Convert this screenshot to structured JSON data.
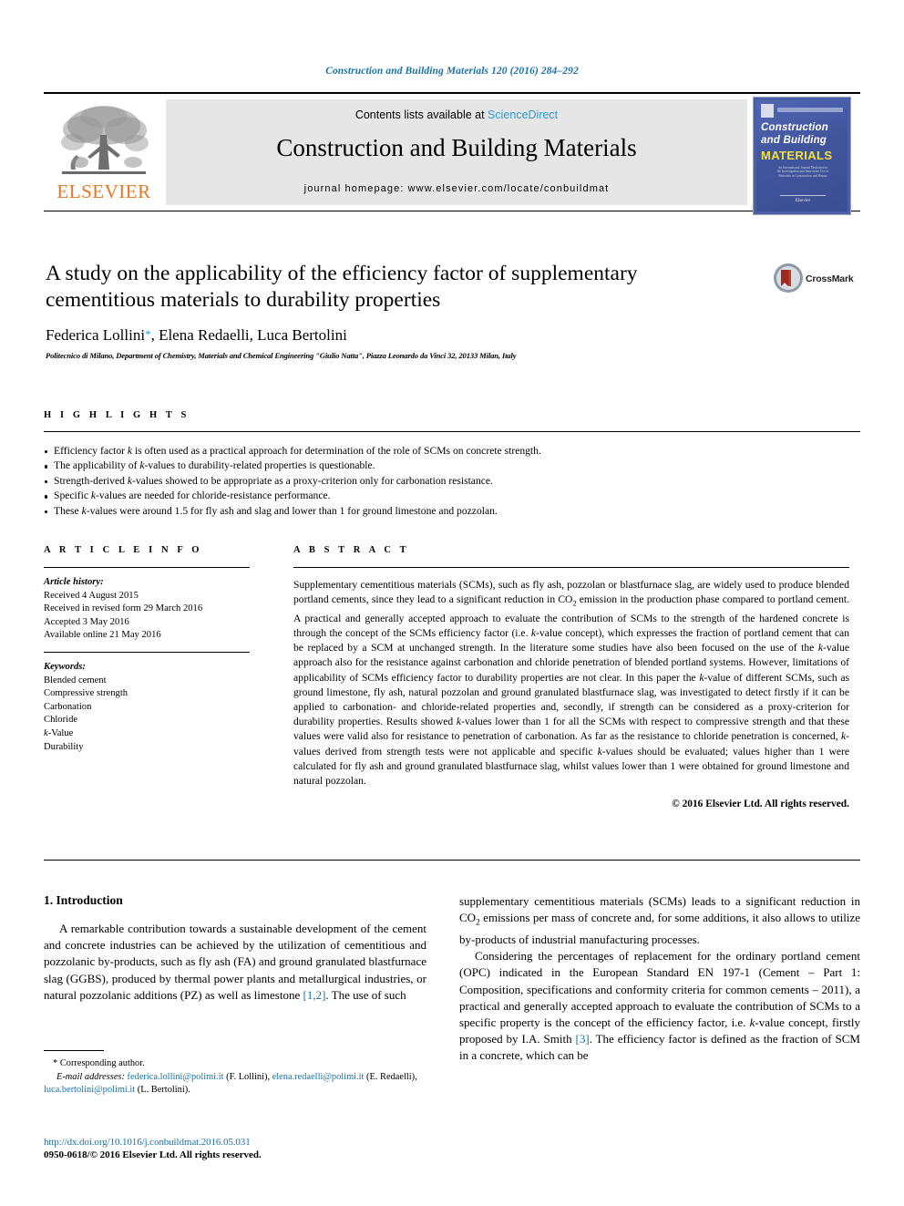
{
  "running_head": "Construction and Building Materials 120 (2016) 284–292",
  "masthead": {
    "contents_prefix": "Contents lists available at ",
    "sciencedirect": "ScienceDirect",
    "journal_title": "Construction and Building Materials",
    "homepage": "journal homepage: www.elsevier.com/locate/conbuildmat",
    "publisher_logo_text": "ELSEVIER",
    "cover": {
      "line1": "Construction",
      "line2": "and Building",
      "line3": "MATERIALS",
      "blurb": "An International Journal Dedicated to the Investigation and Innovative Use of Materials in Construction and Repair",
      "footer": "Elsevier"
    }
  },
  "article": {
    "title": "A study on the applicability of the efficiency factor of supplementary cementitious materials to durability properties",
    "authors": "Federica Lollini",
    "authors_rest": ", Elena Redaelli, Luca Bertolini",
    "corresponding_marker": "*",
    "affiliation": "Politecnico di Milano, Department of Chemistry, Materials and Chemical Engineering \"Giulio Natta\", Piazza Leonardo da Vinci 32, 20133 Milan, Italy",
    "crossmark_label": "CrossMark"
  },
  "highlights": {
    "label": "H I G H L I G H T S",
    "items": [
      "Efficiency factor k is often used as a practical approach for determination of the role of SCMs on concrete strength.",
      "The applicability of k-values to durability-related properties is questionable.",
      "Strength-derived k-values showed to be appropriate as a proxy-criterion only for carbonation resistance.",
      "Specific k-values are needed for chloride-resistance performance.",
      "These k-values were around 1.5 for fly ash and slag and lower than 1 for ground limestone and pozzolan."
    ]
  },
  "article_info": {
    "label": "A R T I C L E   I N F O",
    "history_title": "Article history:",
    "history": [
      "Received 4 August 2015",
      "Received in revised form 29 March 2016",
      "Accepted 3 May 2016",
      "Available online 21 May 2016"
    ],
    "keywords_title": "Keywords:",
    "keywords": [
      "Blended cement",
      "Compressive strength",
      "Carbonation",
      "Chloride",
      "k-Value",
      "Durability"
    ]
  },
  "abstract": {
    "label": "A B S T R A C T",
    "text": "Supplementary cementitious materials (SCMs), such as fly ash, pozzolan or blastfurnace slag, are widely used to produce blended portland cements, since they lead to a significant reduction in CO2 emission in the production phase compared to portland cement. A practical and generally accepted approach to evaluate the contribution of SCMs to the strength of the hardened concrete is through the concept of the SCMs efficiency factor (i.e. k-value concept), which expresses the fraction of portland cement that can be replaced by a SCM at unchanged strength. In the literature some studies have also been focused on the use of the k-value approach also for the resistance against carbonation and chloride penetration of blended portland systems. However, limitations of applicability of SCMs efficiency factor to durability properties are not clear. In this paper the k-value of different SCMs, such as ground limestone, fly ash, natural pozzolan and ground granulated blastfurnace slag, was investigated to detect firstly if it can be applied to carbonation- and chloride-related properties and, secondly, if strength can be considered as a proxy-criterion for durability properties. Results showed k-values lower than 1 for all the SCMs with respect to compressive strength and that these values were valid also for resistance to penetration of carbonation. As far as the resistance to chloride penetration is concerned, k-values derived from strength tests were not applicable and specific k-values should be evaluated; values higher than 1 were calculated for fly ash and ground granulated blastfurnace slag, whilst values lower than 1 were obtained for ground limestone and natural pozzolan.",
    "copyright": "© 2016 Elsevier Ltd. All rights reserved."
  },
  "body": {
    "section_heading": "1. Introduction",
    "left_paragraph_1": "A remarkable contribution towards a sustainable development of the cement and concrete industries can be achieved by the utilization of cementitious and pozzolanic by-products, such as fly ash (FA) and ground granulated blastfurnace slag (GGBS), produced by thermal power plants and metallurgical industries, or natural pozzolanic additions (PZ) as well as limestone ",
    "left_ref_1": "[1,2]",
    "left_paragraph_1_end": ". The use of such",
    "right_paragraph_1": "supplementary cementitious materials (SCMs) leads to a significant reduction in CO2 emissions per mass of concrete and, for some additions, it also allows to utilize by-products of industrial manufacturing processes.",
    "right_paragraph_2_a": "Considering the percentages of replacement for the ordinary portland cement (OPC) indicated in the European Standard EN 197-1 (Cement – Part 1: Composition, specifications and conformity criteria for common cements – 2011), a practical and generally accepted approach to evaluate the contribution of SCMs to a specific property is the concept of the efficiency factor, i.e. k-value concept, firstly proposed by I.A. Smith ",
    "right_ref_1": "[3]",
    "right_paragraph_2_b": ". The efficiency factor is defined as the fraction of SCM in a concrete, which can be"
  },
  "footnote": {
    "corresponding_marker": "*",
    "corresponding_text": "Corresponding author.",
    "emails_label": "E-mail addresses:",
    "email_1": "federica.lollini@polimi.it",
    "email_1_who": "(F. Lollini)",
    "email_2": "elena.redaelli@polimi.it",
    "email_2_who": "(E. Redaelli)",
    "email_3": "luca.bertolini@polimi.it",
    "email_3_who": "(L. Bertolini)."
  },
  "footer": {
    "doi": "http://dx.doi.org/10.1016/j.conbuildmat.2016.05.031",
    "issn_line": "0950-0618/© 2016 Elsevier Ltd. All rights reserved."
  },
  "colors": {
    "link": "#1a72a8",
    "sciencedirect": "#2e9bd6",
    "elsevier_orange": "#e87722",
    "band_gray": "#e6e6e6"
  }
}
